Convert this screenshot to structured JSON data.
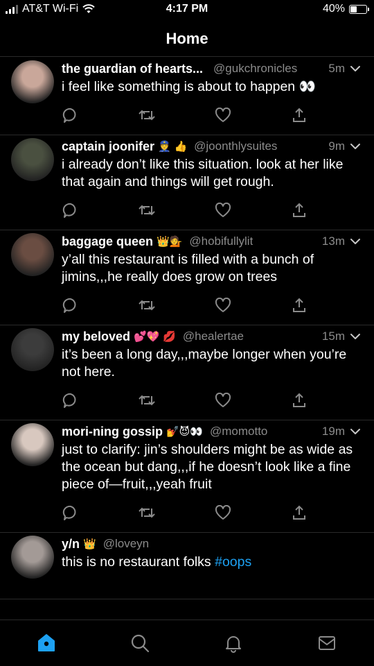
{
  "status_bar": {
    "carrier": "AT&T Wi-Fi",
    "time": "4:17 PM",
    "battery_percent": "40%",
    "battery_level": 0.4
  },
  "header": {
    "title": "Home"
  },
  "tweets": [
    {
      "name": "the guardian of hearts...",
      "emoji": "",
      "handle": "@gukchronicles",
      "time": "5m",
      "text": "i feel like something is about to happen 👀",
      "avatar_color": "#c9a79a"
    },
    {
      "name": "captain joonifer",
      "emoji": "👮 👍",
      "handle": "@joonthlysuites",
      "time": "9m",
      "text": "i already don’t like this situation. look at her like that again and things will get rough.",
      "avatar_color": "#4a5040"
    },
    {
      "name": "baggage queen",
      "emoji": "👑💁",
      "handle": "@hobifullylit",
      "time": "13m",
      "text": "y’all this restaurant is filled with a bunch of jimins,,,he really does grow on trees",
      "avatar_color": "#6a4d42"
    },
    {
      "name": "my beloved",
      "emoji": "💕💖 💋",
      "handle": "@healertae",
      "time": "15m",
      "text": "it’s been a long day,,,maybe longer when you’re not here.",
      "avatar_color": "#3c3c3c"
    },
    {
      "name": "mori-ning gossip",
      "emoji": "💅😈👀",
      "handle": "@momotto",
      "time": "19m",
      "text": "just to clarify: jin’s shoulders might be as wide as the ocean but dang,,,if he doesn’t look like a fine piece of—fruit,,,yeah fruit",
      "avatar_color": "#d8c8bf"
    },
    {
      "name": "y/n",
      "emoji": "👑",
      "handle": "@loveyn",
      "time": "",
      "text": "this is no restaurant folks",
      "hashtag": "#oops",
      "avatar_color": "#a39a96"
    }
  ]
}
